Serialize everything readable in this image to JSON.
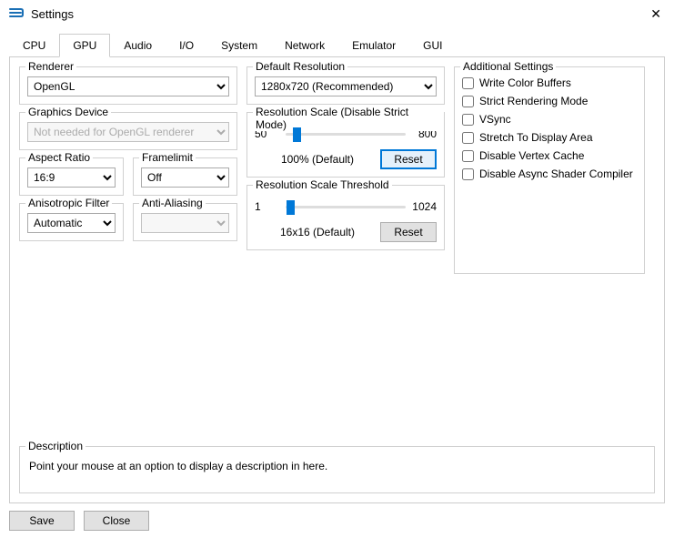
{
  "window": {
    "title": "Settings"
  },
  "tabs": [
    "CPU",
    "GPU",
    "Audio",
    "I/O",
    "System",
    "Network",
    "Emulator",
    "GUI"
  ],
  "active_tab": "GPU",
  "renderer": {
    "label": "Renderer",
    "value": "OpenGL"
  },
  "graphics_device": {
    "label": "Graphics Device",
    "value": "Not needed for OpenGL renderer"
  },
  "aspect_ratio": {
    "label": "Aspect Ratio",
    "value": "16:9"
  },
  "framelimit": {
    "label": "Framelimit",
    "value": "Off"
  },
  "aniso": {
    "label": "Anisotropic Filter",
    "value": "Automatic"
  },
  "aa": {
    "label": "Anti-Aliasing",
    "value": ""
  },
  "default_res": {
    "label": "Default Resolution",
    "value": "1280x720 (Recommended)"
  },
  "res_scale": {
    "label": "Resolution Scale (Disable Strict Mode)",
    "min": "50",
    "max": "800",
    "status": "100% (Default)",
    "reset": "Reset"
  },
  "res_thresh": {
    "label": "Resolution Scale Threshold",
    "min": "1",
    "max": "1024",
    "status": "16x16 (Default)",
    "reset": "Reset"
  },
  "additional": {
    "label": "Additional Settings",
    "items": [
      "Write Color Buffers",
      "Strict Rendering Mode",
      "VSync",
      "Stretch To Display Area",
      "Disable Vertex Cache",
      "Disable Async Shader Compiler"
    ]
  },
  "description": {
    "label": "Description",
    "text": "Point your mouse at an option to display a description in here."
  },
  "footer": {
    "save": "Save",
    "close": "Close"
  }
}
